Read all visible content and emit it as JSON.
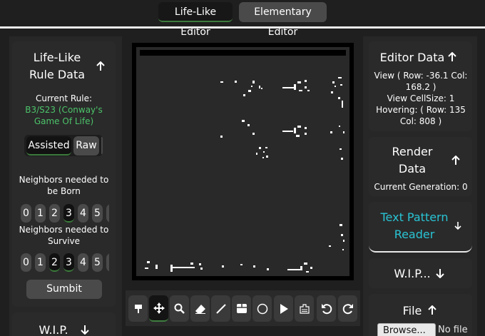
{
  "tabs": [
    {
      "label": "Life-Like Editor",
      "active": true
    },
    {
      "label": "Elementary Editor",
      "active": false
    }
  ],
  "rule_panel": {
    "title_line1": "Life-Like",
    "title_line2": "Rule Data",
    "current_rule_label": "Current Rule:",
    "current_rule_value_line1": "B3/S23 (Conway's",
    "current_rule_value_line2": "Game Of Life)",
    "mode_tabs": [
      {
        "label": "Assisted",
        "active": true
      },
      {
        "label": "Raw",
        "active": false
      }
    ],
    "born_label_line1": "Neighbors needed to",
    "born_label_line2": "be Born",
    "born_values": [
      {
        "label": "0",
        "on": false
      },
      {
        "label": "1",
        "on": false
      },
      {
        "label": "2",
        "on": false
      },
      {
        "label": "3",
        "on": true
      },
      {
        "label": "4",
        "on": false
      },
      {
        "label": "5",
        "on": false
      }
    ],
    "survive_label_line1": "Neighbors needed to",
    "survive_label_line2": "Survive",
    "survive_values": [
      {
        "label": "0",
        "on": false
      },
      {
        "label": "1",
        "on": false
      },
      {
        "label": "2",
        "on": true
      },
      {
        "label": "3",
        "on": true
      },
      {
        "label": "4",
        "on": false
      },
      {
        "label": "5",
        "on": false
      }
    ],
    "submit_label": "Sumbit",
    "wip_label": "W.I.P."
  },
  "editor_data": {
    "title": "Editor Data",
    "view_line1": "View ( Row: -36.1 Col:",
    "view_line2": "168.2 )",
    "cell_size": "View CellSize: 1",
    "hover_line1": "Hovering: ( Row: 135",
    "hover_line2": "Col: 808 )"
  },
  "render_data": {
    "title_line1": "Render",
    "title_line2": "Data",
    "generation": "Current Generation: 0"
  },
  "text_reader": {
    "title_line1": "Text Pattern",
    "title_line2": "Reader",
    "color": "#29c4d4"
  },
  "wip_right": {
    "title": "W.I.P..."
  },
  "file_panel": {
    "title": "File",
    "browse_label": "Browse...",
    "no_file": "No file"
  },
  "toolbar": {
    "tools": [
      {
        "icon": "paint-bucket-icon",
        "on": false
      },
      {
        "icon": "move-icon",
        "on": true
      },
      {
        "icon": "zoom-icon",
        "on": false
      },
      {
        "icon": "eraser-icon",
        "on": false
      },
      {
        "icon": "line-icon",
        "on": false
      },
      {
        "icon": "rectangle-icon",
        "on": false
      },
      {
        "icon": "circle-icon",
        "on": false
      },
      {
        "icon": "play-icon",
        "on": false
      },
      {
        "icon": "clear-grid-icon",
        "on": false
      },
      {
        "icon": "undo-icon",
        "on": false
      },
      {
        "icon": "redo-icon",
        "on": false
      }
    ]
  },
  "colors": {
    "accent_green": "#4cc36a",
    "accent_cyan": "#29c4d4",
    "background": "#1f1f1f"
  }
}
